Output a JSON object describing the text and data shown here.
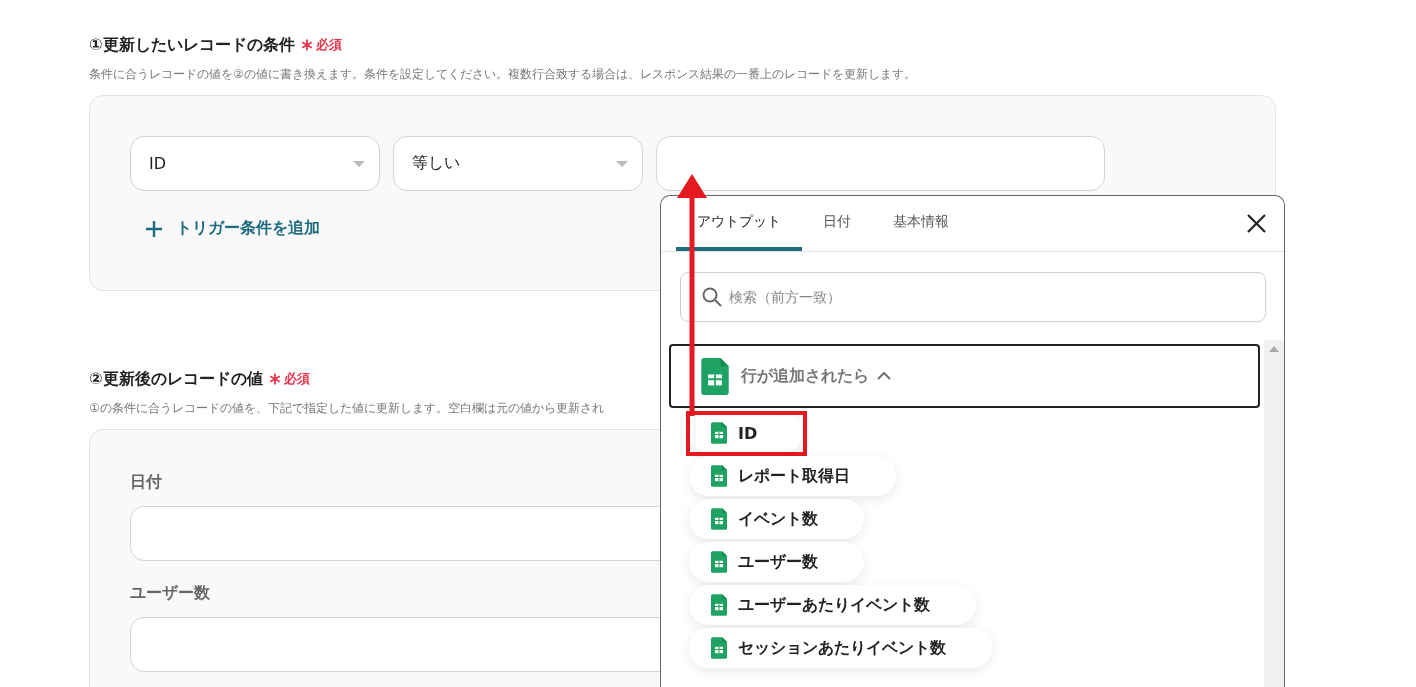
{
  "section1": {
    "title": "①更新したいレコードの条件",
    "required": "必須",
    "description": "条件に合うレコードの値を②の値に書き換えます。条件を設定してください。複数行合致する場合は、レスポンス結果の一番上のレコードを更新します。",
    "conditions": [
      {
        "field": "ID",
        "operator": "等しい"
      }
    ],
    "add_button": "トリガー条件を追加"
  },
  "section2": {
    "title": "②更新後のレコードの値",
    "required": "必須",
    "description": "①の条件に合うレコードの値を、下記で指定した値に更新します。空白欄は元の値から更新され",
    "fields": [
      {
        "label": "日付"
      },
      {
        "label": "ユーザー数"
      }
    ]
  },
  "panel": {
    "tabs": [
      {
        "label": "アウトプット",
        "selected": true
      },
      {
        "label": "日付",
        "selected": false
      },
      {
        "label": "基本情報",
        "selected": false
      }
    ],
    "search": {
      "placeholder": "検索（前方一致）"
    },
    "group": {
      "title": "行が追加されたら",
      "expanded": true,
      "items": [
        {
          "label": "ID",
          "highlighted": true
        },
        {
          "label": "レポート取得日",
          "highlighted": false
        },
        {
          "label": "イベント数",
          "highlighted": false
        },
        {
          "label": "ユーザー数",
          "highlighted": false
        },
        {
          "label": "ユーザーあたりイベント数",
          "highlighted": false
        },
        {
          "label": "セッションあたりイベント数",
          "highlighted": false
        }
      ]
    }
  }
}
